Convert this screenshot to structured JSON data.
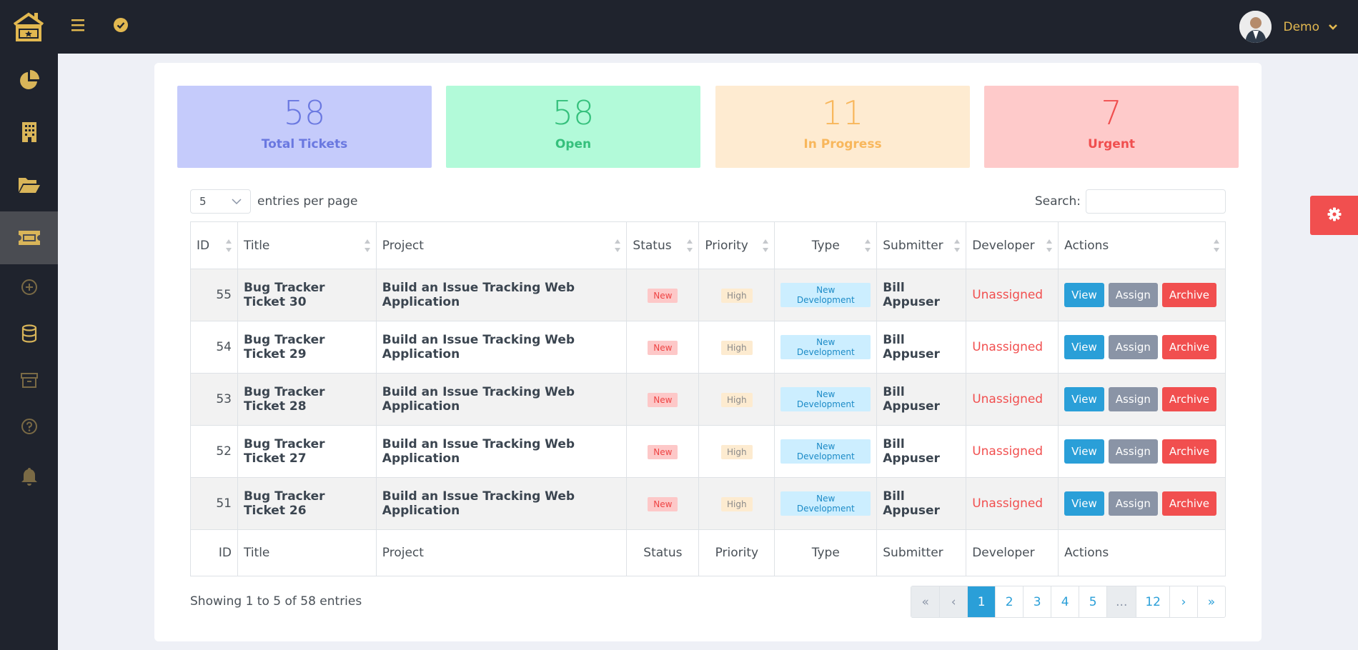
{
  "user": {
    "name": "Demo"
  },
  "stats": [
    {
      "value": "58",
      "label": "Total Tickets",
      "bg": "#c5cbfb",
      "color": "#6a78e0"
    },
    {
      "value": "58",
      "label": "Open",
      "bg": "#b2fad9",
      "color": "#35c07c"
    },
    {
      "value": "11",
      "label": "In Progress",
      "bg": "#feebd1",
      "color": "#f8b75c"
    },
    {
      "value": "7",
      "label": "Urgent",
      "bg": "#fecaca",
      "color": "#f04f4f"
    }
  ],
  "entries": {
    "value": "5",
    "label": "entries per page"
  },
  "search": {
    "label": "Search:",
    "placeholder": ""
  },
  "table": {
    "headers": [
      "ID",
      "Title",
      "Project",
      "Status",
      "Priority",
      "Type",
      "Submitter",
      "Developer",
      "Actions"
    ],
    "rows": [
      {
        "id": "55",
        "title": "Bug Tracker Ticket 30",
        "project": "Build an Issue Tracking Web Application",
        "status": "New",
        "priority": "High",
        "type": "New Development",
        "submitter": "Bill Appuser",
        "developer": "Unassigned"
      },
      {
        "id": "54",
        "title": "Bug Tracker Ticket 29",
        "project": "Build an Issue Tracking Web Application",
        "status": "New",
        "priority": "High",
        "type": "New Development",
        "submitter": "Bill Appuser",
        "developer": "Unassigned"
      },
      {
        "id": "53",
        "title": "Bug Tracker Ticket 28",
        "project": "Build an Issue Tracking Web Application",
        "status": "New",
        "priority": "High",
        "type": "New Development",
        "submitter": "Bill Appuser",
        "developer": "Unassigned"
      },
      {
        "id": "52",
        "title": "Bug Tracker Ticket 27",
        "project": "Build an Issue Tracking Web Application",
        "status": "New",
        "priority": "High",
        "type": "New Development",
        "submitter": "Bill Appuser",
        "developer": "Unassigned"
      },
      {
        "id": "51",
        "title": "Bug Tracker Ticket 26",
        "project": "Build an Issue Tracking Web Application",
        "status": "New",
        "priority": "High",
        "type": "New Development",
        "submitter": "Bill Appuser",
        "developer": "Unassigned"
      }
    ],
    "actions": {
      "view": "View",
      "assign": "Assign",
      "archive": "Archive"
    }
  },
  "info": "Showing 1 to 5 of 58 entries",
  "pagination": [
    "«",
    "‹",
    "1",
    "2",
    "3",
    "4",
    "5",
    "...",
    "12",
    "›",
    "»"
  ],
  "colors": {
    "sidebar": "#1f232d",
    "accent": "#e2b850",
    "primary": "#2a9fd8",
    "danger": "#f14f4f",
    "secondary": "#8a94a6"
  },
  "icons": [
    "logo-icon",
    "menu-icon",
    "check-circle-icon",
    "pie-chart-icon",
    "building-icon",
    "folder-open-icon",
    "ticket-icon",
    "plus-circle-icon",
    "database-icon",
    "archive-icon",
    "question-circle-icon",
    "bell-icon",
    "gear-icon",
    "chevron-down-icon"
  ]
}
